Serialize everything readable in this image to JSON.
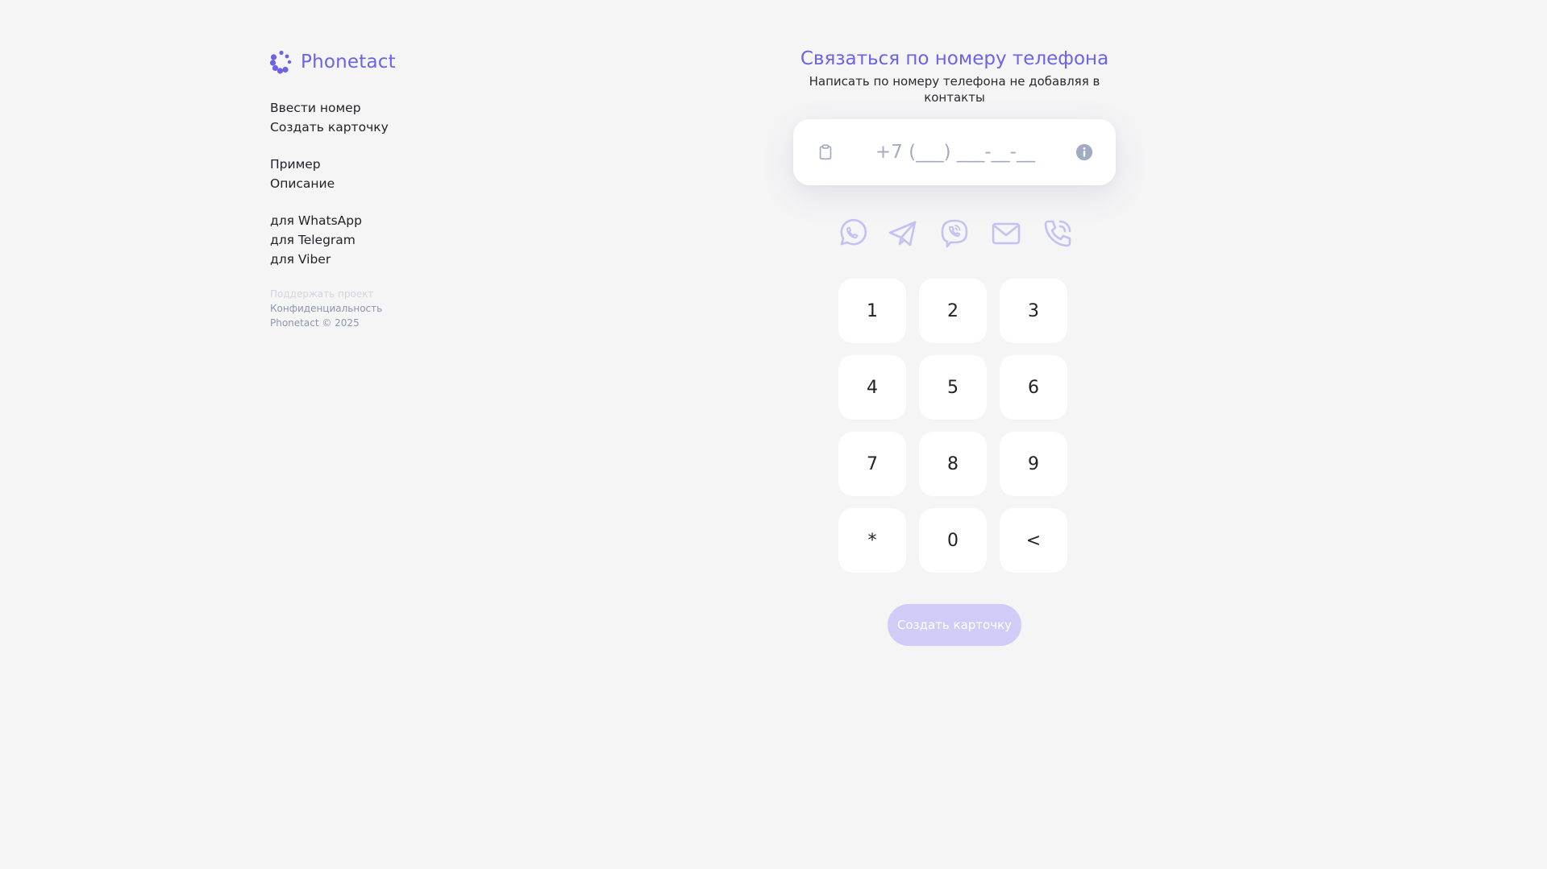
{
  "brand": {
    "name": "Phonetact",
    "logo_icon": "phonetact-dots-logo-icon"
  },
  "sidebar": {
    "groups": [
      {
        "items": [
          {
            "label": "Ввести номер"
          },
          {
            "label": "Создать карточку"
          }
        ]
      },
      {
        "items": [
          {
            "label": "Пример"
          },
          {
            "label": "Описание"
          }
        ]
      },
      {
        "items": [
          {
            "label": "для WhatsApp"
          },
          {
            "label": "для Telegram"
          },
          {
            "label": "для Viber"
          }
        ]
      }
    ],
    "footer": {
      "support": "Поддержать проект",
      "privacy": "Конфиденциальность",
      "copyright": "Phonetact © 2025"
    }
  },
  "main": {
    "title": "Связаться по номеру телефона",
    "subtitle": "Написать по номеру телефона не добавляя в контакты",
    "phone": {
      "placeholder": "+7 (___) ___-__-__",
      "value": "",
      "paste_icon": "clipboard-icon",
      "info_icon": "info-icon"
    },
    "messengers": [
      {
        "name": "whatsapp",
        "icon": "whatsapp-icon"
      },
      {
        "name": "telegram",
        "icon": "telegram-icon"
      },
      {
        "name": "viber",
        "icon": "viber-icon"
      },
      {
        "name": "email",
        "icon": "mail-icon"
      },
      {
        "name": "call",
        "icon": "phone-call-icon"
      }
    ],
    "keypad": [
      "1",
      "2",
      "3",
      "4",
      "5",
      "6",
      "7",
      "8",
      "9",
      "*",
      "0",
      "<"
    ],
    "create_button": "Создать карточку"
  },
  "colors": {
    "accent": "#6b63e6",
    "accent_disabled": "#cfccf8",
    "icon_muted": "#c4c0f2",
    "background": "#f5f5f6"
  }
}
